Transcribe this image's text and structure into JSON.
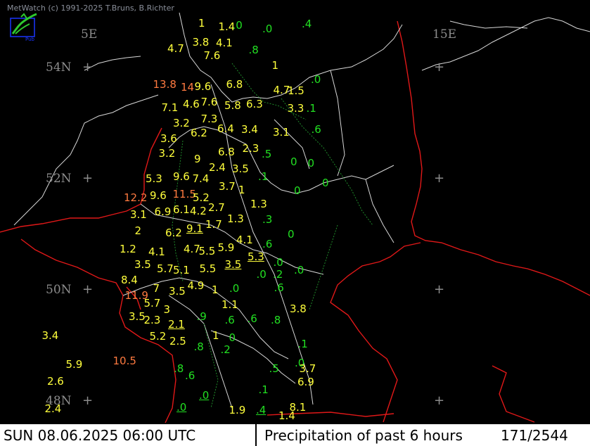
{
  "header": {
    "credit": "MetWatch  (c) 1991-2025 T.Bruns, B.Richter"
  },
  "footer": {
    "datetime": "SUN 08.06.2025 06:00 UTC",
    "product": "Precipitation of past  6 hours",
    "count": "171/2544"
  },
  "legend_colors": {
    "low": "#22e022",
    "mid": "#ffff3c",
    "high": "#ff7a40"
  },
  "grid": {
    "labels": [
      {
        "text": "5E",
        "lon": 5,
        "lat": 54.6
      },
      {
        "text": "15E",
        "lon": 15,
        "lat": 54.6
      },
      {
        "text": "54N",
        "lon": 4,
        "lat": 54
      },
      {
        "text": "52N",
        "lon": 4,
        "lat": 52
      },
      {
        "text": "50N",
        "lon": 4,
        "lat": 50
      },
      {
        "text": "48N",
        "lon": 4,
        "lat": 48
      }
    ],
    "crosses": [
      {
        "lon": 5,
        "lat": 54
      },
      {
        "lon": 15,
        "lat": 54
      },
      {
        "lon": 5,
        "lat": 52
      },
      {
        "lon": 15,
        "lat": 52
      },
      {
        "lon": 5,
        "lat": 50
      },
      {
        "lon": 15,
        "lat": 50
      },
      {
        "lon": 5,
        "lat": 48
      },
      {
        "lon": 15,
        "lat": 48
      }
    ]
  },
  "observations": [
    {
      "v": "1",
      "lon": 8.18,
      "lat": 54.8,
      "c": "mid"
    },
    {
      "v": "1.4",
      "lon": 8.75,
      "lat": 54.74,
      "c": "mid"
    },
    {
      "v": ".0",
      "lon": 9.15,
      "lat": 54.76,
      "c": "low"
    },
    {
      "v": ".0",
      "lon": 10.0,
      "lat": 54.7,
      "c": "low"
    },
    {
      "v": ".4",
      "lon": 11.12,
      "lat": 54.78,
      "c": "low"
    },
    {
      "v": "4.7",
      "lon": 7.3,
      "lat": 54.34,
      "c": "mid"
    },
    {
      "v": "3.8",
      "lon": 8.01,
      "lat": 54.46,
      "c": "mid"
    },
    {
      "v": "4.1",
      "lon": 8.68,
      "lat": 54.44,
      "c": "mid"
    },
    {
      "v": ".8",
      "lon": 9.61,
      "lat": 54.32,
      "c": "low"
    },
    {
      "v": "7.6",
      "lon": 8.33,
      "lat": 54.22,
      "c": "mid"
    },
    {
      "v": "1",
      "lon": 10.27,
      "lat": 54.04,
      "c": "mid"
    },
    {
      "v": "13.8",
      "lon": 6.89,
      "lat": 53.7,
      "c": "high"
    },
    {
      "v": "14",
      "lon": 7.68,
      "lat": 53.64,
      "c": "high"
    },
    {
      "v": "9.6",
      "lon": 8.07,
      "lat": 53.66,
      "c": "mid"
    },
    {
      "v": "6.8",
      "lon": 8.97,
      "lat": 53.7,
      "c": "mid"
    },
    {
      "v": "4.7",
      "lon": 10.31,
      "lat": 53.6,
      "c": "mid"
    },
    {
      "v": "1.5",
      "lon": 10.72,
      "lat": 53.58,
      "c": "mid"
    },
    {
      "v": ".0",
      "lon": 11.38,
      "lat": 53.78,
      "c": "low"
    },
    {
      "v": "7.1",
      "lon": 7.13,
      "lat": 53.28,
      "c": "mid"
    },
    {
      "v": "4.6",
      "lon": 7.74,
      "lat": 53.34,
      "c": "mid"
    },
    {
      "v": "7.6",
      "lon": 8.25,
      "lat": 53.38,
      "c": "mid"
    },
    {
      "v": "5.8",
      "lon": 8.92,
      "lat": 53.32,
      "c": "mid"
    },
    {
      "v": "6.3",
      "lon": 9.54,
      "lat": 53.34,
      "c": "mid"
    },
    {
      "v": "3.3",
      "lon": 10.71,
      "lat": 53.26,
      "c": "mid"
    },
    {
      "v": ".1",
      "lon": 11.25,
      "lat": 53.26,
      "c": "low"
    },
    {
      "v": "3.2",
      "lon": 7.46,
      "lat": 53.0,
      "c": "mid"
    },
    {
      "v": "7.3",
      "lon": 8.25,
      "lat": 53.08,
      "c": "mid"
    },
    {
      "v": "6.2",
      "lon": 7.96,
      "lat": 52.82,
      "c": "mid"
    },
    {
      "v": "6.4",
      "lon": 8.72,
      "lat": 52.9,
      "c": "mid"
    },
    {
      "v": "3.4",
      "lon": 9.4,
      "lat": 52.88,
      "c": "mid"
    },
    {
      "v": "3.1",
      "lon": 10.3,
      "lat": 52.84,
      "c": "mid"
    },
    {
      "v": ".6",
      "lon": 11.39,
      "lat": 52.88,
      "c": "low"
    },
    {
      "v": "3.6",
      "lon": 7.1,
      "lat": 52.72,
      "c": "mid"
    },
    {
      "v": "6.8",
      "lon": 8.74,
      "lat": 52.48,
      "c": "mid"
    },
    {
      "v": "2.3",
      "lon": 9.43,
      "lat": 52.54,
      "c": "mid"
    },
    {
      "v": "3.2",
      "lon": 7.05,
      "lat": 52.46,
      "c": "mid"
    },
    {
      "v": "9",
      "lon": 8.06,
      "lat": 52.36,
      "c": "mid"
    },
    {
      "v": ".5",
      "lon": 9.98,
      "lat": 52.44,
      "c": "low"
    },
    {
      "v": "2.4",
      "lon": 8.48,
      "lat": 52.2,
      "c": "mid"
    },
    {
      "v": "3.5",
      "lon": 9.14,
      "lat": 52.18,
      "c": "mid"
    },
    {
      "v": "0",
      "lon": 10.8,
      "lat": 52.3,
      "c": "low"
    },
    {
      "v": "0",
      "lon": 11.29,
      "lat": 52.28,
      "c": "low"
    },
    {
      "v": "5.3",
      "lon": 6.68,
      "lat": 52.0,
      "c": "mid"
    },
    {
      "v": "9.6",
      "lon": 7.46,
      "lat": 52.04,
      "c": "mid"
    },
    {
      "v": "7.4",
      "lon": 8.01,
      "lat": 52.0,
      "c": "mid"
    },
    {
      "v": ".1",
      "lon": 9.88,
      "lat": 52.04,
      "c": "low"
    },
    {
      "v": "0",
      "lon": 11.7,
      "lat": 51.92,
      "c": "low"
    },
    {
      "v": "3.7",
      "lon": 8.76,
      "lat": 51.86,
      "c": "mid"
    },
    {
      "v": "1",
      "lon": 9.32,
      "lat": 51.8,
      "c": "mid"
    },
    {
      "v": "0",
      "lon": 10.9,
      "lat": 51.78,
      "c": "low"
    },
    {
      "v": "12.2",
      "lon": 6.06,
      "lat": 51.66,
      "c": "high"
    },
    {
      "v": "9.6",
      "lon": 6.8,
      "lat": 51.7,
      "c": "mid"
    },
    {
      "v": "11.5",
      "lon": 7.45,
      "lat": 51.72,
      "c": "high"
    },
    {
      "v": "5.2",
      "lon": 8.02,
      "lat": 51.66,
      "c": "mid"
    },
    {
      "v": "3.1",
      "lon": 6.24,
      "lat": 51.36,
      "c": "mid"
    },
    {
      "v": "6.9",
      "lon": 6.93,
      "lat": 51.4,
      "c": "mid"
    },
    {
      "v": "6.1",
      "lon": 7.46,
      "lat": 51.44,
      "c": "mid"
    },
    {
      "v": "4.2",
      "lon": 7.94,
      "lat": 51.42,
      "c": "mid"
    },
    {
      "v": "2.7",
      "lon": 8.46,
      "lat": 51.48,
      "c": "mid"
    },
    {
      "v": "1.3",
      "lon": 9.66,
      "lat": 51.54,
      "c": "mid"
    },
    {
      "v": "1.3",
      "lon": 9.0,
      "lat": 51.28,
      "c": "mid"
    },
    {
      "v": ".3",
      "lon": 10.0,
      "lat": 51.26,
      "c": "low"
    },
    {
      "v": "1.7",
      "lon": 8.38,
      "lat": 51.18,
      "c": "mid"
    },
    {
      "v": "2",
      "lon": 6.37,
      "lat": 51.06,
      "c": "mid"
    },
    {
      "v": "9.1",
      "lon": 7.84,
      "lat": 51.1,
      "c": "mid",
      "u": true
    },
    {
      "v": "6.2",
      "lon": 7.24,
      "lat": 51.02,
      "c": "mid"
    },
    {
      "v": "0",
      "lon": 10.72,
      "lat": 51.0,
      "c": "low"
    },
    {
      "v": "4.1",
      "lon": 9.26,
      "lat": 50.9,
      "c": "mid"
    },
    {
      "v": ".6",
      "lon": 10.0,
      "lat": 50.82,
      "c": "low"
    },
    {
      "v": "1.2",
      "lon": 5.94,
      "lat": 50.74,
      "c": "mid"
    },
    {
      "v": "4.1",
      "lon": 6.76,
      "lat": 50.68,
      "c": "mid"
    },
    {
      "v": "4.7",
      "lon": 7.76,
      "lat": 50.74,
      "c": "mid"
    },
    {
      "v": "5.5",
      "lon": 8.19,
      "lat": 50.7,
      "c": "mid"
    },
    {
      "v": "5.9",
      "lon": 8.73,
      "lat": 50.76,
      "c": "mid"
    },
    {
      "v": "5.3",
      "lon": 9.58,
      "lat": 50.6,
      "c": "mid",
      "u": true
    },
    {
      "v": ".0",
      "lon": 10.31,
      "lat": 50.5,
      "c": "low"
    },
    {
      "v": "3.5",
      "lon": 6.36,
      "lat": 50.46,
      "c": "mid"
    },
    {
      "v": "5.7",
      "lon": 7.0,
      "lat": 50.38,
      "c": "mid"
    },
    {
      "v": "5.1",
      "lon": 7.46,
      "lat": 50.36,
      "c": "mid"
    },
    {
      "v": "5.5",
      "lon": 8.21,
      "lat": 50.38,
      "c": "mid"
    },
    {
      "v": "3.5",
      "lon": 8.93,
      "lat": 50.46,
      "c": "mid",
      "u": true
    },
    {
      "v": ".0",
      "lon": 10.9,
      "lat": 50.36,
      "c": "low"
    },
    {
      "v": ".0",
      "lon": 9.83,
      "lat": 50.28,
      "c": "low"
    },
    {
      "v": ".2",
      "lon": 10.3,
      "lat": 50.28,
      "c": "low"
    },
    {
      "v": "8.4",
      "lon": 5.98,
      "lat": 50.18,
      "c": "mid"
    },
    {
      "v": "4.9",
      "lon": 7.87,
      "lat": 50.08,
      "c": "mid"
    },
    {
      "v": "7",
      "lon": 6.89,
      "lat": 50.02,
      "c": "mid"
    },
    {
      "v": "3.5",
      "lon": 7.34,
      "lat": 49.98,
      "c": "mid"
    },
    {
      "v": "1",
      "lon": 8.56,
      "lat": 50.0,
      "c": "mid"
    },
    {
      "v": ".0",
      "lon": 9.06,
      "lat": 50.02,
      "c": "low"
    },
    {
      "v": ".6",
      "lon": 10.33,
      "lat": 50.04,
      "c": "low"
    },
    {
      "v": "11.9",
      "lon": 6.09,
      "lat": 49.9,
      "c": "high"
    },
    {
      "v": "5.7",
      "lon": 6.63,
      "lat": 49.76,
      "c": "mid"
    },
    {
      "v": "1.1",
      "lon": 8.84,
      "lat": 49.74,
      "c": "mid"
    },
    {
      "v": "3.8",
      "lon": 10.78,
      "lat": 49.66,
      "c": "mid"
    },
    {
      "v": "3",
      "lon": 7.19,
      "lat": 49.64,
      "c": "mid"
    },
    {
      "v": ".9",
      "lon": 8.13,
      "lat": 49.52,
      "c": "low"
    },
    {
      "v": ".6",
      "lon": 8.93,
      "lat": 49.46,
      "c": "low"
    },
    {
      "v": ".6",
      "lon": 9.57,
      "lat": 49.48,
      "c": "low"
    },
    {
      "v": ".8",
      "lon": 10.24,
      "lat": 49.46,
      "c": "low"
    },
    {
      "v": "3.5",
      "lon": 6.2,
      "lat": 49.52,
      "c": "mid"
    },
    {
      "v": "2.3",
      "lon": 6.63,
      "lat": 49.46,
      "c": "mid"
    },
    {
      "v": "2.1",
      "lon": 7.32,
      "lat": 49.38,
      "c": "mid",
      "u": true
    },
    {
      "v": "3.4",
      "lon": 3.73,
      "lat": 49.18,
      "c": "mid"
    },
    {
      "v": "1",
      "lon": 8.58,
      "lat": 49.18,
      "c": "mid"
    },
    {
      "v": "0",
      "lon": 9.05,
      "lat": 49.14,
      "c": "low"
    },
    {
      "v": "5.2",
      "lon": 6.79,
      "lat": 49.16,
      "c": "mid"
    },
    {
      "v": "2.5",
      "lon": 7.36,
      "lat": 49.08,
      "c": "mid"
    },
    {
      "v": ".1",
      "lon": 11.01,
      "lat": 49.02,
      "c": "low"
    },
    {
      "v": ".8",
      "lon": 8.05,
      "lat": 48.98,
      "c": "low"
    },
    {
      "v": ".2",
      "lon": 8.81,
      "lat": 48.92,
      "c": "low"
    },
    {
      "v": "10.5",
      "lon": 5.75,
      "lat": 48.72,
      "c": "high"
    },
    {
      "v": "5.9",
      "lon": 4.41,
      "lat": 48.66,
      "c": "mid"
    },
    {
      "v": ".0",
      "lon": 10.92,
      "lat": 48.68,
      "c": "low"
    },
    {
      "v": ".5",
      "lon": 10.19,
      "lat": 48.58,
      "c": "low"
    },
    {
      "v": "3.7",
      "lon": 11.05,
      "lat": 48.58,
      "c": "mid"
    },
    {
      "v": ".8",
      "lon": 7.48,
      "lat": 48.58,
      "c": "low"
    },
    {
      "v": ".6",
      "lon": 7.8,
      "lat": 48.46,
      "c": "low"
    },
    {
      "v": "2.6",
      "lon": 3.88,
      "lat": 48.36,
      "c": "mid"
    },
    {
      "v": "6.9",
      "lon": 11.0,
      "lat": 48.34,
      "c": "mid"
    },
    {
      "v": ".1",
      "lon": 9.89,
      "lat": 48.2,
      "c": "low"
    },
    {
      "v": ".0",
      "lon": 8.2,
      "lat": 48.1,
      "c": "low",
      "u": true
    },
    {
      "v": "8.1",
      "lon": 10.77,
      "lat": 47.88,
      "c": "mid"
    },
    {
      "v": "2.4",
      "lon": 3.81,
      "lat": 47.86,
      "c": "mid"
    },
    {
      "v": ".0",
      "lon": 7.56,
      "lat": 47.88,
      "c": "low",
      "u": true
    },
    {
      "v": "1.9",
      "lon": 9.05,
      "lat": 47.84,
      "c": "mid"
    },
    {
      "v": ".4",
      "lon": 9.82,
      "lat": 47.84,
      "c": "low",
      "u": true
    },
    {
      "v": "1.4",
      "lon": 10.46,
      "lat": 47.62,
      "c": "mid"
    }
  ]
}
